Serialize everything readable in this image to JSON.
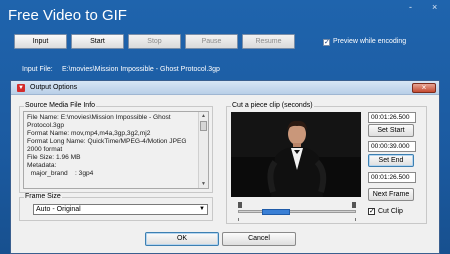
{
  "app": {
    "title": "Free Video to GIF",
    "window_controls": [
      "-",
      "×"
    ]
  },
  "toolbar": {
    "input_label": "Input",
    "start_label": "Start",
    "stop_label": "Stop",
    "pause_label": "Pause",
    "resume_label": "Resume",
    "preview_checked": true,
    "preview_label": "Preview while encoding"
  },
  "input_file": {
    "label": "Input File:",
    "value": "E:\\movies\\Mission Impossible - Ghost Protocol.3gp"
  },
  "dialog": {
    "icon_glyph": "▼",
    "title": "Output Options",
    "close_glyph": "×",
    "source_group_title": "Source Media File Info",
    "source_lines": [
      "File Name: E:\\movies\\Mission Impossible - Ghost",
      "Protocol.3gp",
      "Format Name: mov,mp4,m4a,3gp,3g2,mj2",
      "Format Long Name: QuickTime/MPEG-4/Motion JPEG",
      "2000 format",
      "File Size: 1.96 MB",
      "Metadata:",
      "  major_brand    : 3gp4"
    ],
    "frame_group_title": "Frame Size",
    "frame_size_value": "Auto - Original",
    "clip_group_title": "Cut a piece clip (seconds)",
    "start_time": "00:01:26.500",
    "set_start_label": "Set Start",
    "duration_time": "00:00:39.000",
    "set_end_label": "Set End",
    "end_time": "00:01:26.500",
    "next_frame_label": "Next Frame",
    "cut_clip_checked": true,
    "cut_clip_label": "Cut Clip",
    "ok_label": "OK",
    "cancel_label": "Cancel"
  },
  "colors": {
    "main_bg": "#1b5aa0",
    "slider_selection": "#3a7fd5"
  }
}
